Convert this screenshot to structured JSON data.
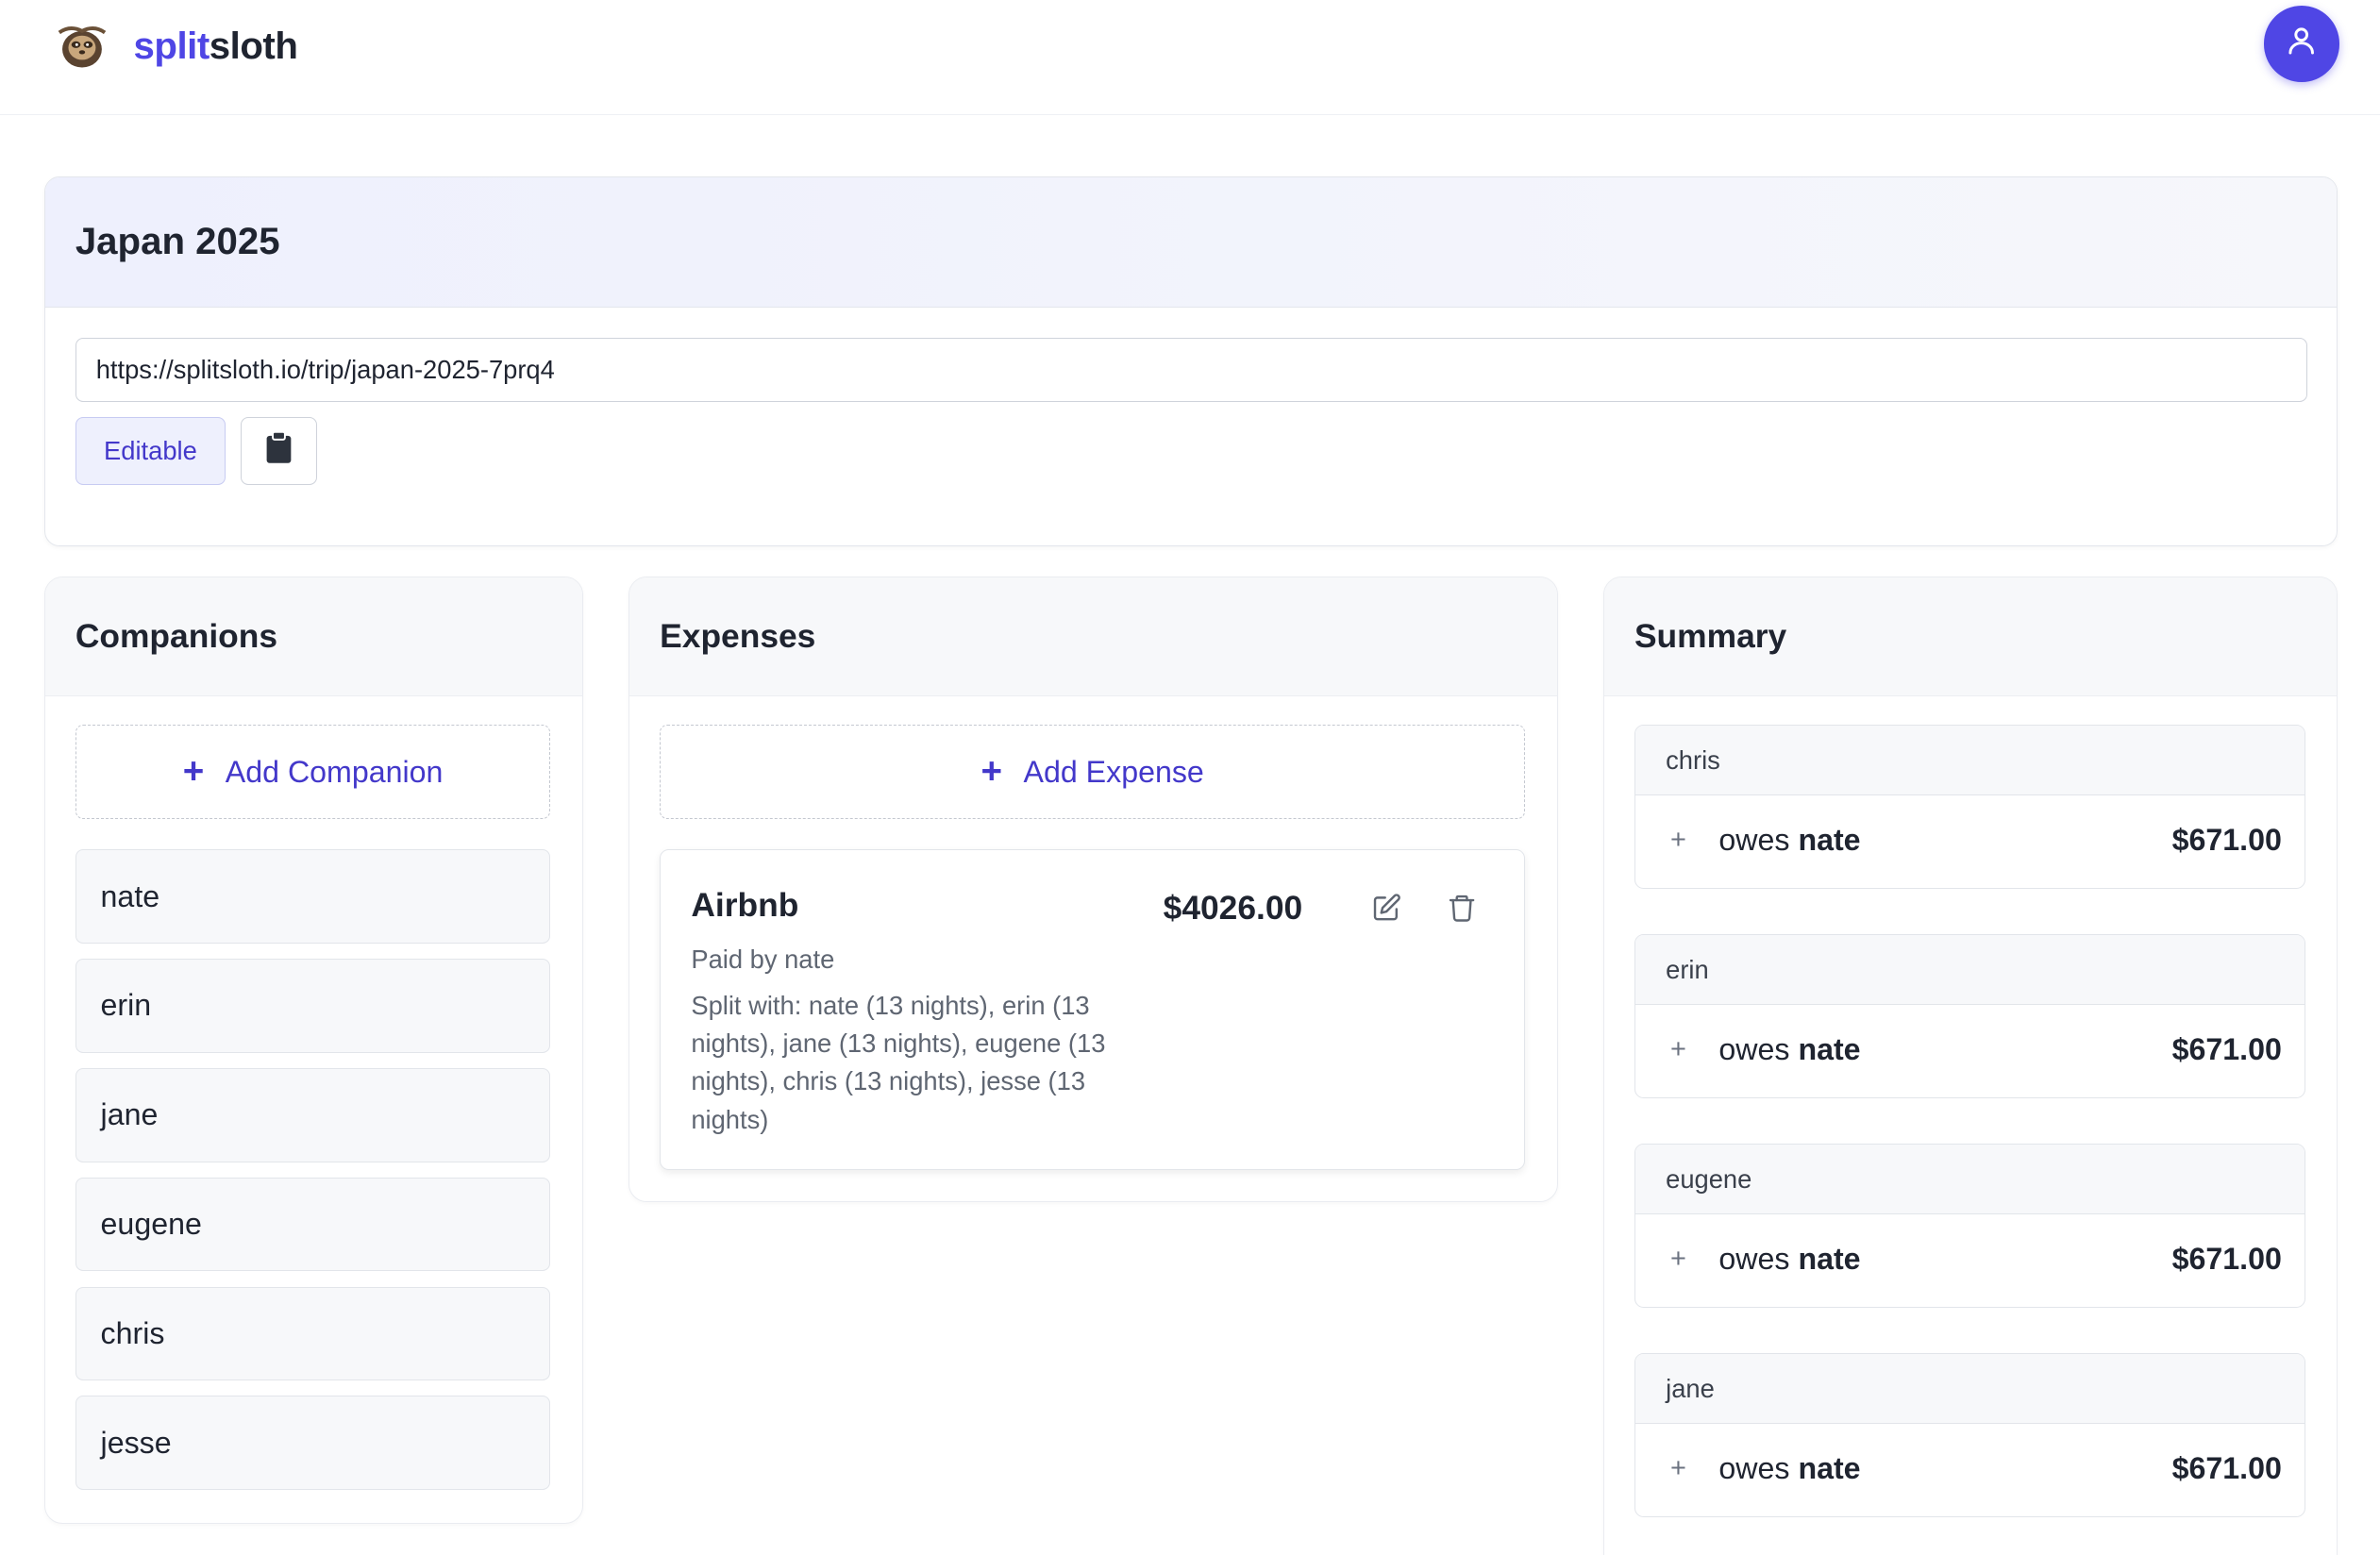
{
  "app": {
    "brand_part1": "split",
    "brand_part2": "sloth"
  },
  "trip": {
    "title": "Japan 2025",
    "share_url": "https://splitsloth.io/trip/japan-2025-7prq4",
    "mode_label": "Editable"
  },
  "companions": {
    "title": "Companions",
    "add_label": "Add Companion",
    "items": [
      "nate",
      "erin",
      "jane",
      "eugene",
      "chris",
      "jesse"
    ]
  },
  "expenses": {
    "title": "Expenses",
    "add_label": "Add Expense",
    "items": [
      {
        "name": "Airbnb",
        "amount": "$4026.00",
        "paid_by": "Paid by nate",
        "split": "Split with: nate (13 nights), erin (13 nights), jane (13 nights), eugene (13 nights), chris (13 nights), jesse (13 nights)"
      }
    ]
  },
  "summary": {
    "title": "Summary",
    "items": [
      {
        "person": "chris",
        "plus": "+",
        "owes": "owes",
        "to": "nate",
        "amount": "$671.00"
      },
      {
        "person": "erin",
        "plus": "+",
        "owes": "owes",
        "to": "nate",
        "amount": "$671.00"
      },
      {
        "person": "eugene",
        "plus": "+",
        "owes": "owes",
        "to": "nate",
        "amount": "$671.00"
      },
      {
        "person": "jane",
        "plus": "+",
        "owes": "owes",
        "to": "nate",
        "amount": "$671.00"
      }
    ]
  },
  "colors": {
    "accent": "#4f46e5",
    "accent_text": "#4338ca",
    "panel_bg": "#f7f8fa"
  },
  "icons": [
    "sloth-logo-icon",
    "user-icon",
    "clipboard-icon",
    "plus-icon",
    "edit-icon",
    "trash-icon"
  ]
}
